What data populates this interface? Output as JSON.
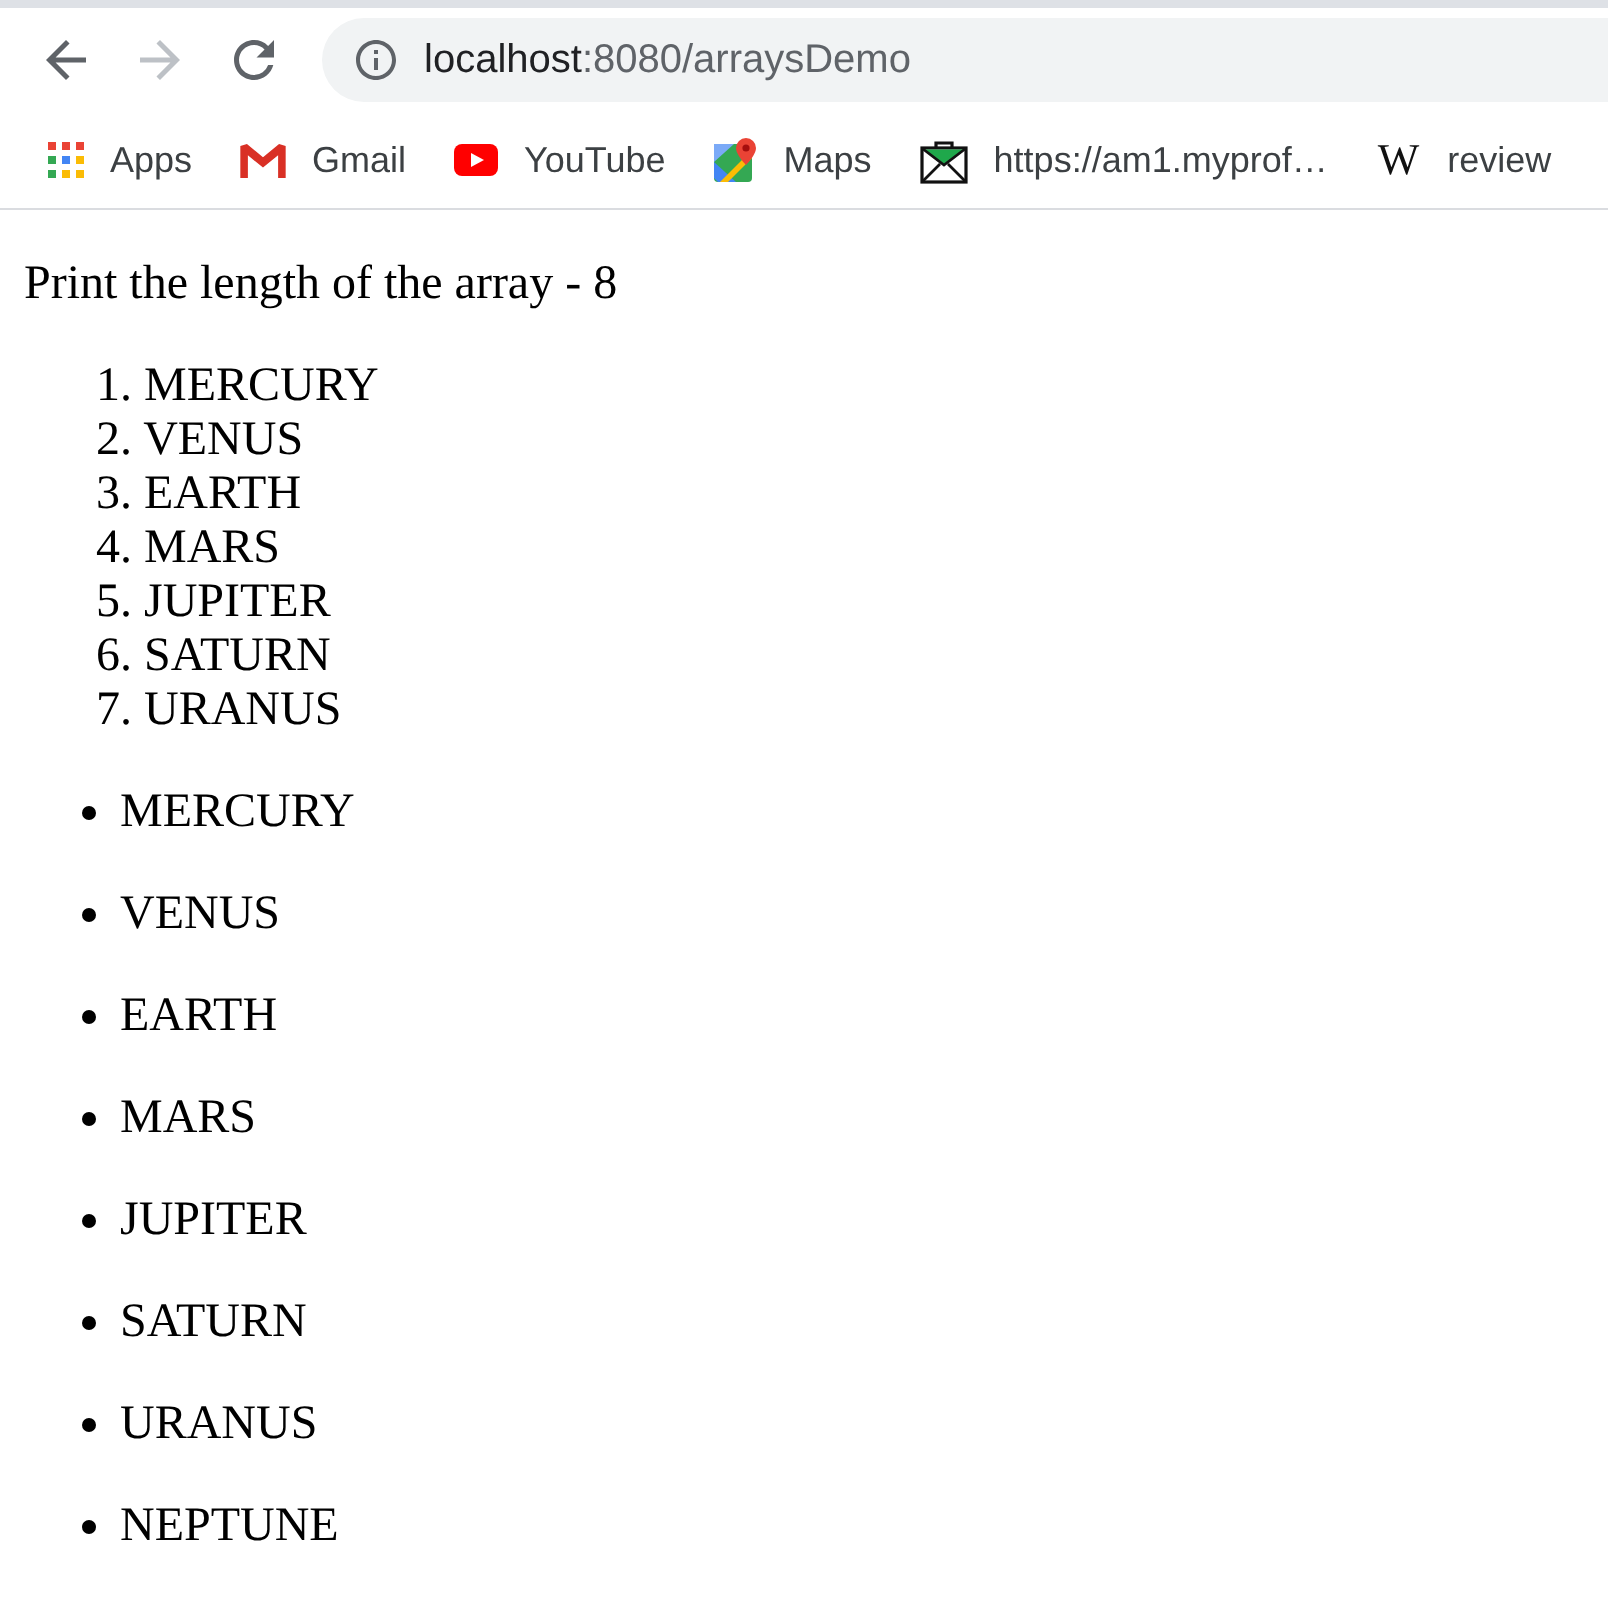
{
  "toolbar": {
    "nav_buttons": [
      {
        "kind": "back",
        "disabled": false
      },
      {
        "kind": "forward",
        "disabled": true
      },
      {
        "kind": "reload",
        "disabled": false
      }
    ],
    "address_bar": {
      "host": "localhost",
      "path": ":8080/arraysDemo"
    }
  },
  "bookmarks": [
    {
      "kind": "apps",
      "label": "Apps"
    },
    {
      "kind": "mail",
      "label": "Gmail"
    },
    {
      "kind": "video",
      "label": "YouTube"
    },
    {
      "kind": "map",
      "label": "Maps"
    },
    {
      "kind": "envelope",
      "label": "https://am1.myprof…"
    },
    {
      "kind": "letter",
      "glyph": "W",
      "label": "review"
    }
  ],
  "page": {
    "heading": "Print the length of the array - 8",
    "ordered_list": [
      {
        "number": "1.",
        "text": "MERCURY"
      },
      {
        "number": "2.",
        "text": "VENUS"
      },
      {
        "number": "3.",
        "text": "EARTH"
      },
      {
        "number": "4.",
        "text": "MARS"
      },
      {
        "number": "5.",
        "text": "JUPITER"
      },
      {
        "number": "6.",
        "text": "SATURN"
      },
      {
        "number": "7.",
        "text": "URANUS"
      }
    ],
    "bullet_list": [
      "MERCURY",
      "VENUS",
      "EARTH",
      "MARS",
      "JUPITER",
      "SATURN",
      "URANUS",
      "NEPTUNE"
    ]
  }
}
